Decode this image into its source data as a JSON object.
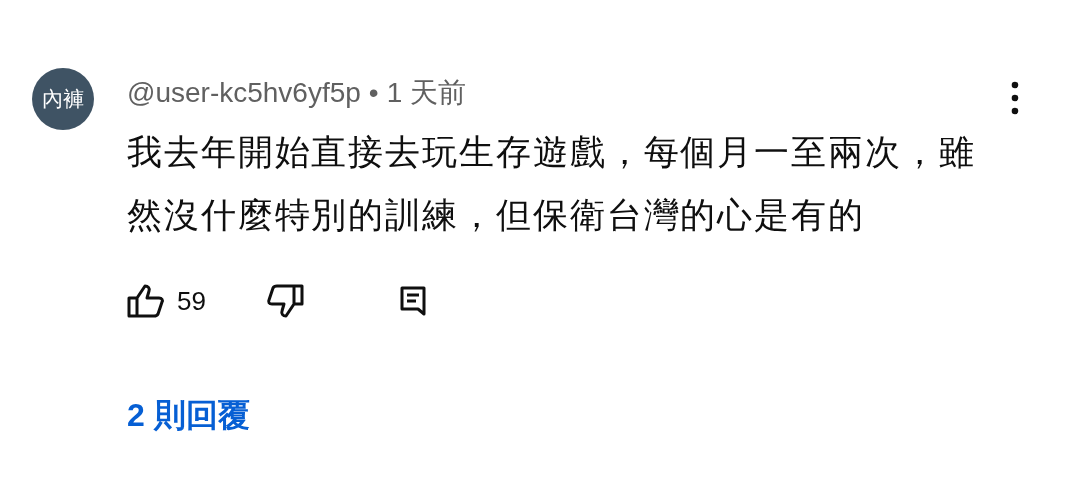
{
  "comment": {
    "avatar_text": "內褲",
    "author": "@user-kc5hv6yf5p",
    "separator": "•",
    "time": "1 天前",
    "text": "我去年開始直接去玩生存遊戲，每個月一至兩次，雖然沒什麼特別的訓練，但保衛台灣的心是有的",
    "likes": "59",
    "liked": false,
    "disliked": false,
    "replies": "2 則回覆"
  }
}
